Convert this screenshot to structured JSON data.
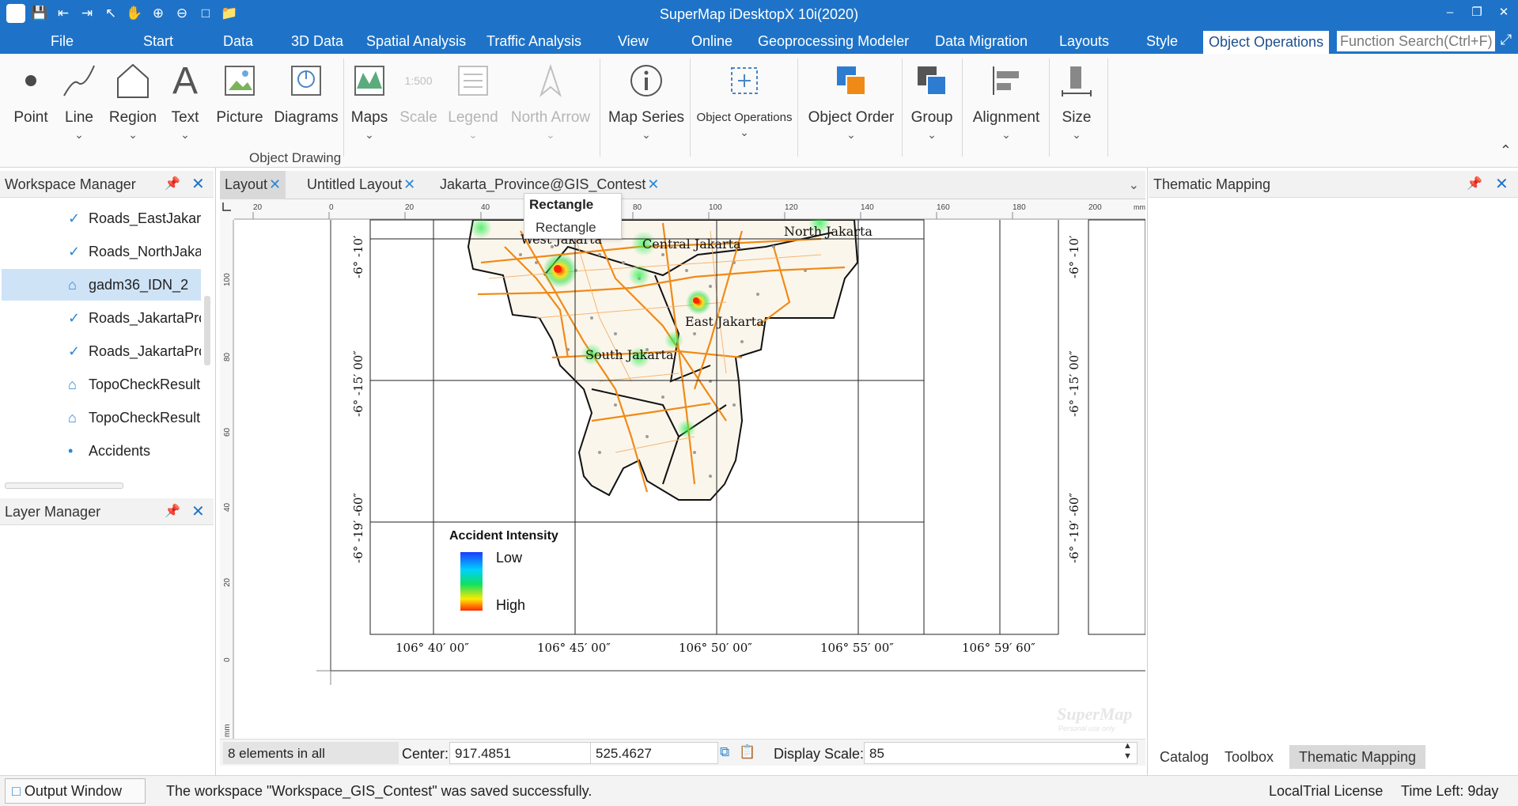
{
  "app": {
    "title": "SuperMap iDesktopX 10i(2020)"
  },
  "quick_access": [
    "app-logo-icon",
    "save-icon",
    "back-icon",
    "forward-icon",
    "select-icon",
    "pan-icon",
    "zoom-in-icon",
    "zoom-out-icon",
    "full-extent-icon",
    "open-folder-icon"
  ],
  "menu": [
    "File",
    "Start",
    "Data",
    "3D Data",
    "Spatial Analysis",
    "Traffic Analysis",
    "View",
    "Online",
    "Geoprocessing Modeler",
    "Data Migration",
    "Layouts",
    "Style",
    "Object Operations"
  ],
  "active_menu": "Object Operations",
  "function_search_placeholder": "Function Search(Ctrl+F)",
  "ribbon": {
    "buttons": [
      {
        "label": "Point",
        "dropdown": false,
        "enabled": true
      },
      {
        "label": "Line",
        "dropdown": true,
        "enabled": true
      },
      {
        "label": "Region",
        "dropdown": true,
        "enabled": true
      },
      {
        "label": "Text",
        "dropdown": true,
        "enabled": true
      },
      {
        "label": "Picture",
        "dropdown": false,
        "enabled": true
      },
      {
        "label": "Diagrams",
        "dropdown": false,
        "enabled": true
      },
      {
        "label": "Maps",
        "dropdown": true,
        "enabled": true
      },
      {
        "label": "Scale",
        "dropdown": false,
        "enabled": false
      },
      {
        "label": "Legend",
        "dropdown": true,
        "enabled": false
      },
      {
        "label": "North Arrow",
        "dropdown": true,
        "enabled": false
      },
      {
        "label": "Map Series",
        "dropdown": true,
        "enabled": true
      },
      {
        "label": "Object Operations",
        "dropdown": true,
        "enabled": true
      },
      {
        "label": "Object Order",
        "dropdown": true,
        "enabled": true
      },
      {
        "label": "Group",
        "dropdown": true,
        "enabled": true
      },
      {
        "label": "Alignment",
        "dropdown": true,
        "enabled": true
      },
      {
        "label": "Size",
        "dropdown": true,
        "enabled": true
      }
    ],
    "group_label": "Object Drawing",
    "scale_icon_text": "1:500"
  },
  "workspace_manager": {
    "title": "Workspace Manager",
    "items": [
      {
        "label": "Roads_EastJakart",
        "icon": "line-layer-icon",
        "selected": false
      },
      {
        "label": "Roads_NorthJaka",
        "icon": "line-layer-icon",
        "selected": false
      },
      {
        "label": "gadm36_IDN_2",
        "icon": "region-layer-icon",
        "selected": true
      },
      {
        "label": "Roads_JakartaPrc",
        "icon": "line-layer-icon",
        "selected": false
      },
      {
        "label": "Roads_JakartaPrc",
        "icon": "line-layer-icon",
        "selected": false
      },
      {
        "label": "TopoCheckResult",
        "icon": "region-layer-icon",
        "selected": false
      },
      {
        "label": "TopoCheckResult",
        "icon": "region-layer-icon",
        "selected": false
      },
      {
        "label": "Accidents",
        "icon": "point-layer-icon",
        "selected": false
      }
    ]
  },
  "layer_manager": {
    "title": "Layer Manager"
  },
  "doc_tabs": [
    {
      "label": "Layout",
      "active": true
    },
    {
      "label": "Untitled Layout",
      "active": false
    },
    {
      "label": "Jakarta_Province@GIS_Contest",
      "active": false
    }
  ],
  "tooltip": {
    "title": "Rectangle",
    "item": "Rectangle"
  },
  "layout": {
    "ruler_top": [
      "20",
      "0",
      "20",
      "40",
      "60",
      "80",
      "100",
      "120",
      "140",
      "160",
      "180",
      "200",
      "mm"
    ],
    "ruler_left": [
      "100",
      "80",
      "60",
      "40",
      "20",
      "0",
      "mm"
    ],
    "lat_labels": [
      "-6° -10′",
      "-6° -15′ 00″",
      "-6° -19′ -60″"
    ],
    "lon_labels": [
      "106° 40′ 00″",
      "106° 45′ 00″",
      "106° 50′ 00″",
      "106° 55′ 00″",
      "106° 59′ 60″"
    ],
    "districts": [
      "North Jakarta",
      "West Jakarta",
      "Central Jakarta",
      "East Jakarta",
      "South Jakarta"
    ],
    "legend": {
      "title": "Accident Intensity",
      "low": "Low",
      "high": "High"
    },
    "watermark": "SuperMap",
    "watermark_sub": "Personal use only"
  },
  "layout_status": {
    "elements": "8 elements in all",
    "center_label": "Center:",
    "center_x": "917.4851",
    "center_y": "525.4627",
    "scale_label": "Display Scale:",
    "scale_value": "85"
  },
  "thematic_panel": {
    "title": "Thematic Mapping"
  },
  "right_tabs": [
    {
      "label": "Catalog",
      "active": false
    },
    {
      "label": "Toolbox",
      "active": false
    },
    {
      "label": "Thematic Mapping",
      "active": true
    }
  ],
  "statusbar": {
    "output_button": "Output Window",
    "message": "The workspace \"Workspace_GIS_Contest\" was saved successfully.",
    "license": "LocalTrial License",
    "time_left": "Time Left: 9day"
  },
  "colors": {
    "accent": "#1e73c8",
    "selected": "#cfe3f7",
    "roads": "#f08a17"
  }
}
